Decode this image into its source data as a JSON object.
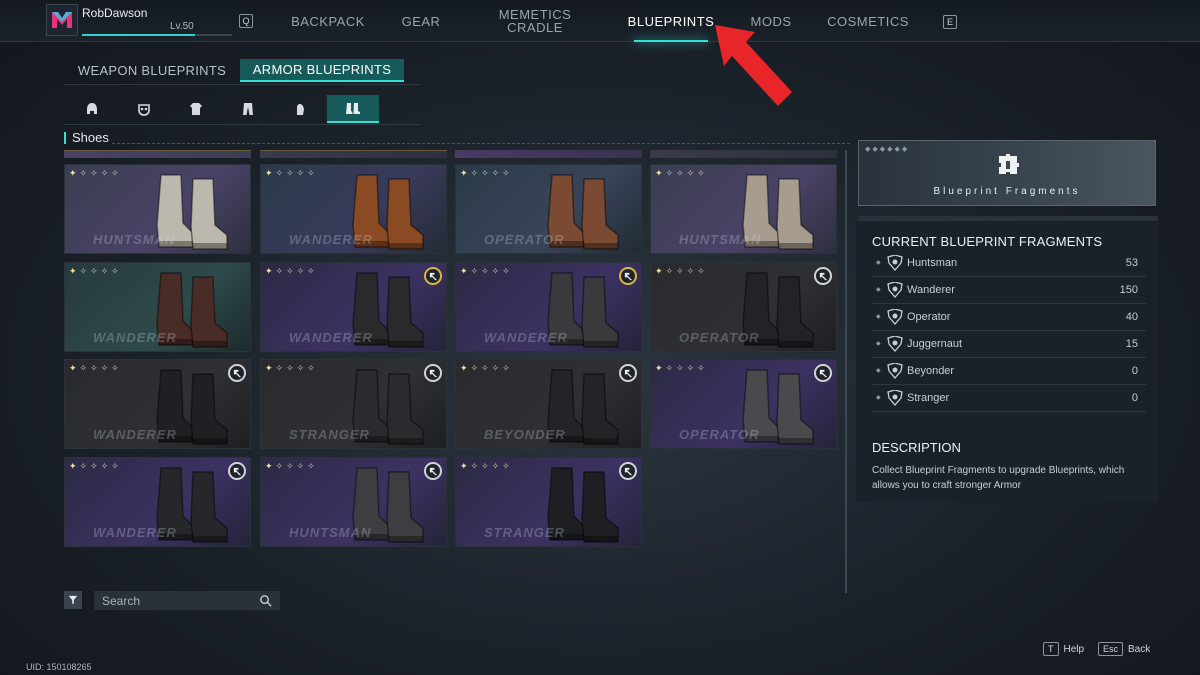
{
  "profile": {
    "name": "RobDawson",
    "level": "Lv.50",
    "xp_fraction": 0.75
  },
  "nav": {
    "left_key": "Q",
    "right_key": "E",
    "tabs": [
      {
        "label": "BACKPACK",
        "active": false
      },
      {
        "label": "GEAR",
        "active": false
      },
      {
        "label": "MEMETICS CRADLE",
        "active": false
      },
      {
        "label": "BLUEPRINTS",
        "active": true
      },
      {
        "label": "MODS",
        "active": false
      },
      {
        "label": "COSMETICS",
        "active": false
      }
    ]
  },
  "subtabs": [
    {
      "label": "WEAPON BLUEPRINTS",
      "active": false
    },
    {
      "label": "ARMOR BLUEPRINTS",
      "active": true
    }
  ],
  "categories": [
    {
      "icon": "helmet-icon",
      "active": false
    },
    {
      "icon": "mask-icon",
      "active": false
    },
    {
      "icon": "top-icon",
      "active": false
    },
    {
      "icon": "pants-icon",
      "active": false
    },
    {
      "icon": "gloves-icon",
      "active": false
    },
    {
      "icon": "shoes-icon",
      "active": true
    }
  ],
  "section_title": "Shoes",
  "cards": [
    {
      "brand": "HUNTSMAN",
      "theme": "huntsman",
      "badge": "none",
      "boot_color": "#bdb8ad"
    },
    {
      "brand": "WANDERER",
      "theme": "wanderer",
      "badge": "none",
      "boot_color": "#8a4a24"
    },
    {
      "brand": "OPERATOR",
      "theme": "operator",
      "badge": "none",
      "boot_color": "#7a4a32"
    },
    {
      "brand": "HUNTSMAN",
      "theme": "huntsman",
      "badge": "none",
      "boot_color": "#a89c8e"
    },
    {
      "brand": "WANDERER",
      "theme": "wandererB",
      "badge": "none",
      "boot_color": "#4a2c26"
    },
    {
      "brand": "WANDERER",
      "theme": "violet",
      "badge": "gold",
      "boot_color": "#2a2a2c"
    },
    {
      "brand": "WANDERER",
      "theme": "violet",
      "badge": "gold",
      "boot_color": "#3a3a3c"
    },
    {
      "brand": "OPERATOR",
      "theme": "dark",
      "badge": "white",
      "boot_color": "#222326"
    },
    {
      "brand": "WANDERER",
      "theme": "dark",
      "badge": "white",
      "boot_color": "#1f2023"
    },
    {
      "brand": "STRANGER",
      "theme": "dark",
      "badge": "white",
      "boot_color": "#2a2b2e"
    },
    {
      "brand": "BEYONDER",
      "theme": "dark",
      "badge": "white",
      "boot_color": "#232427"
    },
    {
      "brand": "OPERATOR",
      "theme": "violet",
      "badge": "white",
      "boot_color": "#4a4a4e"
    },
    {
      "brand": "WANDERER",
      "theme": "violet",
      "badge": "white",
      "boot_color": "#26272a"
    },
    {
      "brand": "HUNTSMAN",
      "theme": "violet",
      "badge": "white",
      "boot_color": "#3e3e42"
    },
    {
      "brand": "STRANGER",
      "theme": "violet",
      "badge": "white",
      "boot_color": "#1e1f22"
    }
  ],
  "search": {
    "placeholder": "Search"
  },
  "uid": "UID: 150108265",
  "banner": {
    "title": "Blueprint Fragments"
  },
  "fragments": {
    "heading": "CURRENT BLUEPRINT FRAGMENTS",
    "items": [
      {
        "name": "Huntsman",
        "value": "53"
      },
      {
        "name": "Wanderer",
        "value": "150"
      },
      {
        "name": "Operator",
        "value": "40"
      },
      {
        "name": "Juggernaut",
        "value": "15"
      },
      {
        "name": "Beyonder",
        "value": "0"
      },
      {
        "name": "Stranger",
        "value": "0"
      }
    ]
  },
  "description": {
    "heading": "DESCRIPTION",
    "text": "Collect Blueprint Fragments to upgrade Blueprints, which allows you to craft stronger Armor"
  },
  "footer": {
    "help_key": "T",
    "help_label": "Help",
    "back_key": "Esc",
    "back_label": "Back"
  },
  "colors": {
    "accent": "#33e0d5",
    "tab_active_bg": "#165b5a",
    "arrow": "#e8262a"
  }
}
